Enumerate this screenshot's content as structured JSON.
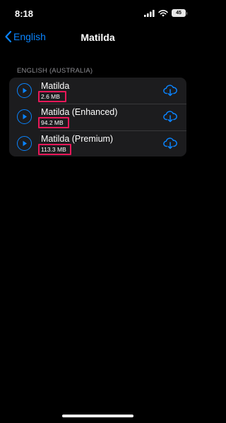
{
  "status_bar": {
    "time": "8:18",
    "battery": "45"
  },
  "nav": {
    "back_label": "English",
    "title": "Matilda"
  },
  "section": {
    "header": "ENGLISH (AUSTRALIA)"
  },
  "voices": [
    {
      "name": "Matilda",
      "size": "2.6 MB"
    },
    {
      "name": "Matilda (Enhanced)",
      "size": "94.2 MB"
    },
    {
      "name": "Matilda (Premium)",
      "size": "113.3 MB"
    }
  ],
  "colors": {
    "accent": "#0a84ff",
    "highlight": "#e8185a",
    "background": "#000000",
    "cell": "#1c1c1e"
  },
  "icons": {
    "play": "play-icon",
    "download": "icloud-download-icon",
    "back": "chevron-left-icon"
  }
}
